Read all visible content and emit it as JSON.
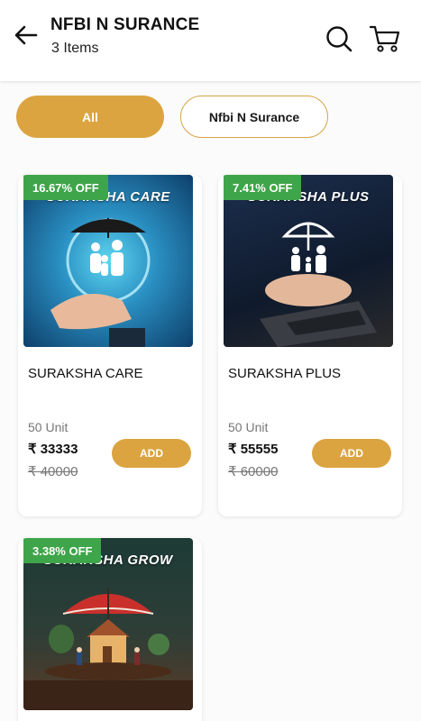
{
  "header": {
    "title": "NFBI N SURANCE",
    "subtitle": "3 Items",
    "back_icon": "arrow-left-icon",
    "search_icon": "search-icon",
    "cart_icon": "cart-icon"
  },
  "filters": {
    "all_label": "All",
    "category_label": "Nfbi N Surance",
    "accent": "#dba440"
  },
  "products": [
    {
      "badge": "16.67% OFF",
      "image_title": "SURAKSHA CARE",
      "name": "SURAKSHA CARE",
      "unit": "50 Unit",
      "price": "₹ 33333",
      "mrp": "₹ 40000",
      "add_label": "ADD"
    },
    {
      "badge": "7.41% OFF",
      "image_title": "SURAKSHA PLUS",
      "name": "SURAKSHA PLUS",
      "unit": "50 Unit",
      "price": "₹ 55555",
      "mrp": "₹ 60000",
      "add_label": "ADD"
    },
    {
      "badge": "3.38% OFF",
      "image_title": "SURAKSHA GROW"
    }
  ],
  "colors": {
    "badge_green": "#3fa54a",
    "button_gold": "#dba440"
  }
}
